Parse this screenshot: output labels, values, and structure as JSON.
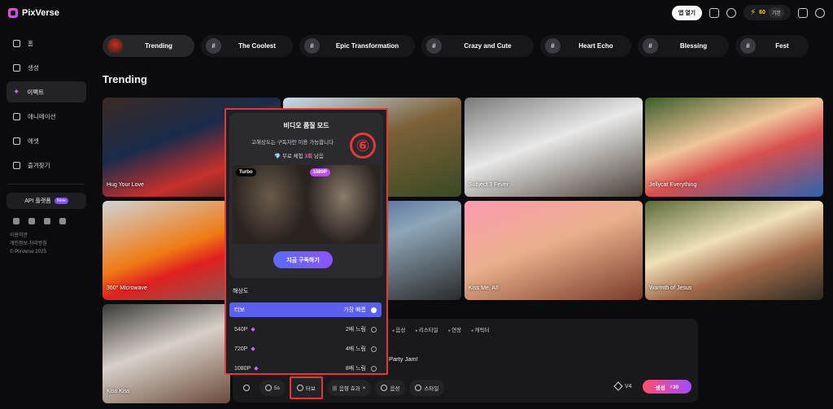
{
  "app": {
    "name": "PixVerse"
  },
  "topbar": {
    "open_app": "앱 열기",
    "credits": "60",
    "plan": "기본"
  },
  "sidebar": {
    "items": [
      {
        "label": "홈"
      },
      {
        "label": "생성"
      },
      {
        "label": "이펙트"
      },
      {
        "label": "애니메이션"
      },
      {
        "label": "에셋"
      },
      {
        "label": "즐겨찾기"
      }
    ],
    "api_label": "API 플랫폼",
    "api_badge": "New",
    "footer": [
      "이용약관",
      "개인정보 처리방침",
      "© PixVerse 2025"
    ]
  },
  "categories": [
    {
      "label": "Trending",
      "icon": "thumbnail"
    },
    {
      "label": "The Coolest",
      "icon": "#"
    },
    {
      "label": "Epic Transformation",
      "icon": "#"
    },
    {
      "label": "Crazy and Cute",
      "icon": "#"
    },
    {
      "label": "Heart Echo",
      "icon": "#"
    },
    {
      "label": "Blessing",
      "icon": "#"
    },
    {
      "label": "Fest",
      "icon": "#"
    }
  ],
  "section_title": "Trending",
  "cards": [
    "Hug Your Love",
    "",
    "Subject 3 Fever",
    "Jellycat Everything",
    "360° Microwave",
    "",
    "Kiss Me, AI!",
    "Warmth of Jesus",
    "Kiss Kiss"
  ],
  "editor": {
    "tabs": [
      "음성",
      "리스타일",
      "연장",
      "캐릭터"
    ],
    "prompt": "Party Jam!",
    "toolbar": {
      "duration": "5s",
      "quality": "터보",
      "sound": "음향 효과",
      "voice": "음성",
      "style": "스타일"
    },
    "model": "V4",
    "generate": "생성",
    "generate_cost": "30"
  },
  "popup": {
    "title": "비디오 품질 모드",
    "desc": "고해상도는 구독자만 이용 가능합니다",
    "trial_prefix": "무료 체험 ",
    "trial_count": "3회",
    "trial_suffix": " 남음",
    "tag_left": "Turbo",
    "tag_right": "1080P",
    "subscribe": "지금 구독하기",
    "res_label": "해상도",
    "badge": "⑥",
    "options": [
      {
        "name": "터보",
        "speed": "가장 빠름",
        "selected": true,
        "premium": false
      },
      {
        "name": "540P",
        "speed": "2배 느림",
        "selected": false,
        "premium": true
      },
      {
        "name": "720P",
        "speed": "4배 느림",
        "selected": false,
        "premium": true
      },
      {
        "name": "1080P",
        "speed": "8배 느림",
        "selected": false,
        "premium": true
      }
    ]
  }
}
